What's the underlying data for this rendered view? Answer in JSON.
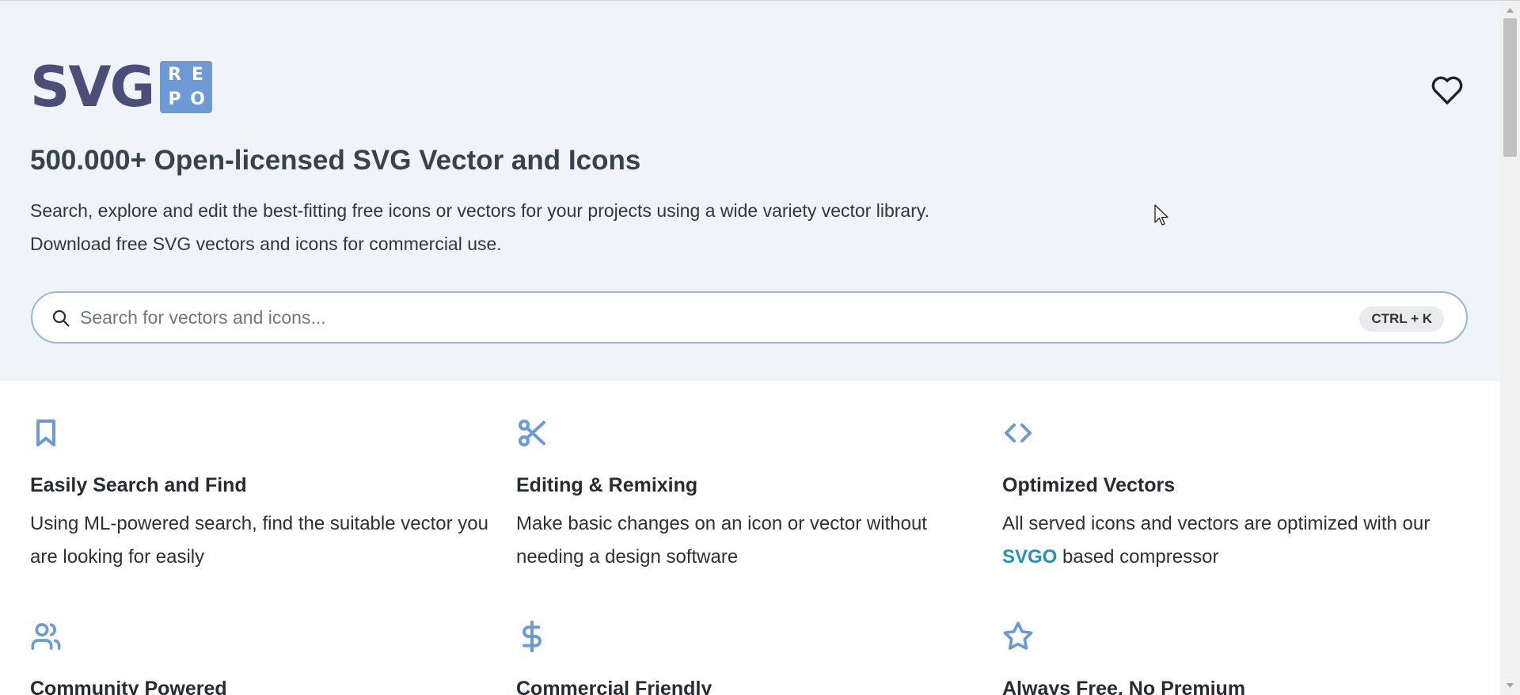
{
  "logo": {
    "text": "SVG",
    "badge": [
      "R",
      "E",
      "P",
      "O"
    ]
  },
  "header": {
    "title": "500.000+ Open-licensed SVG Vector and Icons",
    "subtitle_line1": "Search, explore and edit the best-fitting free icons or vectors for your projects using a wide variety vector library.",
    "subtitle_line2": "Download free SVG vectors and icons for commercial use."
  },
  "search": {
    "placeholder": "Search for vectors and icons...",
    "value": "",
    "shortcut": "CTRL + K"
  },
  "features": [
    {
      "icon": "bookmark-icon",
      "title": "Easily Search and Find",
      "desc": "Using ML-powered search, find the suitable vector you are looking for easily"
    },
    {
      "icon": "scissors-icon",
      "title": "Editing & Remixing",
      "desc": "Make basic changes on an icon or vector without needing a design software"
    },
    {
      "icon": "code-icon",
      "title": "Optimized Vectors",
      "desc_pre": "All served icons and vectors are optimized with our ",
      "link": "SVGO",
      "desc_post": " based compressor"
    },
    {
      "icon": "users-icon",
      "title": "Community Powered"
    },
    {
      "icon": "dollar-icon",
      "title": "Commercial Friendly"
    },
    {
      "icon": "star-icon",
      "title": "Always Free, No Premium"
    }
  ],
  "colors": {
    "hero_bg": "#f0f3f8",
    "accent": "#6d9ad5",
    "logo_text": "#4a4e78",
    "link": "#2a8fb8"
  }
}
